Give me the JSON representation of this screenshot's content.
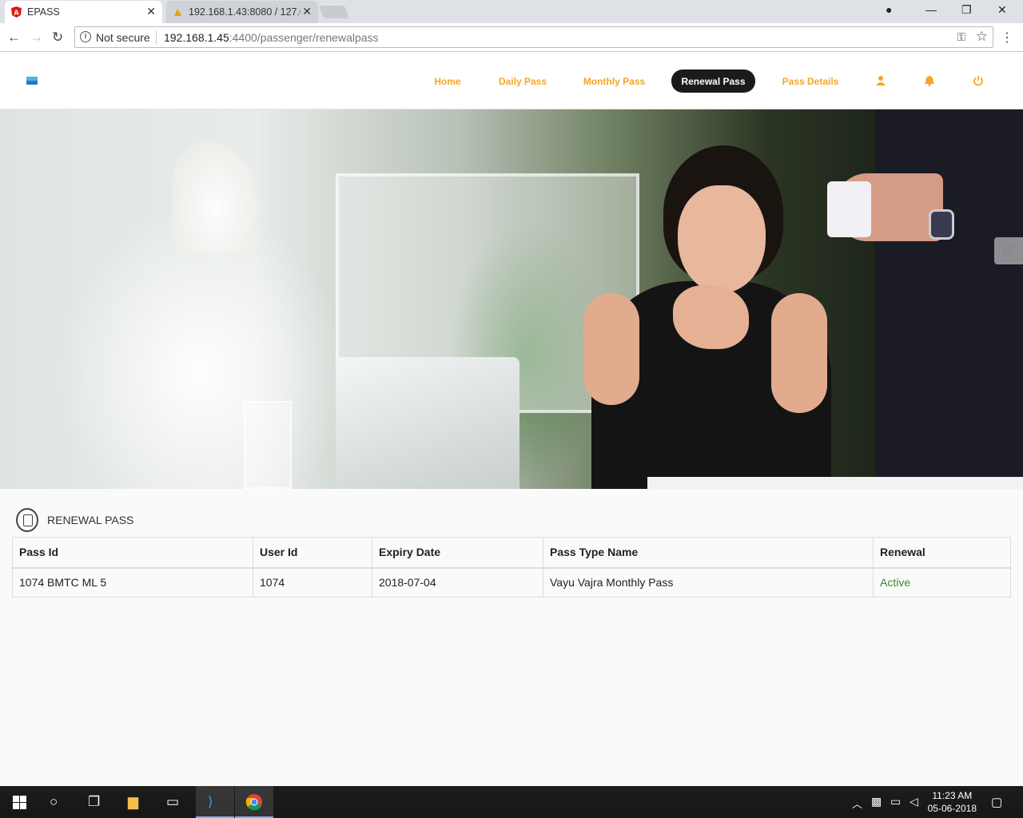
{
  "browser": {
    "tabs": [
      {
        "title": "EPASS"
      },
      {
        "title": "192.168.1.43:8080 / 127.0"
      }
    ],
    "security_label": "Not secure",
    "url_host": "192.168.1.45",
    "url_rest": ":4400/passenger/renewalpass"
  },
  "nav": {
    "items": [
      "Home",
      "Daily Pass",
      "Monthly Pass",
      "Renewal Pass",
      "Pass Details"
    ],
    "active": "Renewal Pass"
  },
  "section": {
    "title": "RENEWAL PASS"
  },
  "table": {
    "headers": [
      "Pass Id",
      "User Id",
      "Expiry Date",
      "Pass Type Name",
      "Renewal"
    ],
    "rows": [
      [
        "1074 BMTC ML 5",
        "1074",
        "2018-07-04",
        "Vayu Vajra Monthly Pass",
        "Active"
      ]
    ]
  },
  "taskbar": {
    "time": "11:23 AM",
    "date": "05-06-2018"
  },
  "colors": {
    "accent": "#f5a623",
    "active_nav_bg": "#1b1b1b",
    "status_active": "#3a8a2a"
  }
}
